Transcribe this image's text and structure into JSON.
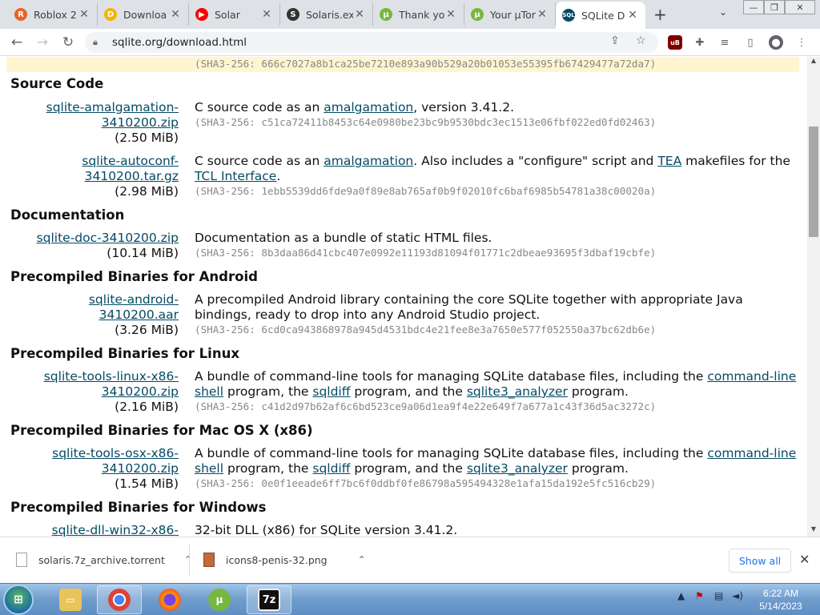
{
  "tabs": [
    {
      "title": "Roblox 2",
      "fav": "R",
      "color": "#e8632c"
    },
    {
      "title": "Downloa",
      "fav": "D",
      "color": "#f4b400"
    },
    {
      "title": "Solar",
      "fav": "▶",
      "color": "#ff0000"
    },
    {
      "title": "Solaris.ex",
      "fav": "S",
      "color": "#333333"
    },
    {
      "title": "Thank yo",
      "fav": "µ",
      "color": "#76b83f"
    },
    {
      "title": "Your µTor",
      "fav": "µ",
      "color": "#76b83f"
    },
    {
      "title": "SQLite D",
      "fav": "SQL",
      "color": "#044a64"
    }
  ],
  "toolbar": {
    "url": "sqlite.org/download.html"
  },
  "content": {
    "top_sha": "(SHA3-256: 666c7027a8b1ca25be7210e893a90b529a20b01053e55395fb67429477a72da7)",
    "sections": [
      {
        "heading": "Source Code",
        "files": [
          {
            "name1": "sqlite-amalgamation-",
            "name2": "3410200.zip",
            "size": "(2.50 MiB)",
            "desc": [
              "C source code as an ",
              {
                "link": "amalgamation"
              },
              ", version 3.41.2."
            ],
            "sha": "(SHA3-256: c51ca72411b8453c64e0980be23bc9b9530bdc3ec1513e06fbf022ed0fd02463)"
          },
          {
            "name1": "sqlite-autoconf-",
            "name2": "3410200.tar.gz",
            "size": "(2.98 MiB)",
            "desc": [
              "C source code as an ",
              {
                "link": "amalgamation"
              },
              ". Also includes a \"configure\" script and ",
              {
                "link": "TEA"
              },
              " makefiles for the ",
              {
                "link": "TCL Interface"
              },
              "."
            ],
            "sha": "(SHA3-256: 1ebb5539dd6fde9a0f89e8ab765af0b9f02010fc6baf6985b54781a38c00020a)"
          }
        ]
      },
      {
        "heading": "Documentation",
        "files": [
          {
            "name1": "sqlite-doc-3410200.zip",
            "name2": "",
            "size": "(10.14 MiB)",
            "desc": [
              "Documentation as a bundle of static HTML files."
            ],
            "sha": "(SHA3-256: 8b3daa86d41cbc407e0992e11193d81094f01771c2dbeae93695f3dbaf19cbfe)"
          }
        ]
      },
      {
        "heading": "Precompiled Binaries for Android",
        "files": [
          {
            "name1": "sqlite-android-",
            "name2": "3410200.aar",
            "size": "(3.26 MiB)",
            "desc": [
              "A precompiled Android library containing the core SQLite together with appropriate Java bindings, ready to drop into any Android Studio project."
            ],
            "sha": "(SHA3-256: 6cd0ca943868978a945d4531bdc4e21fee8e3a7650e577f052550a37bc62db6e)"
          }
        ]
      },
      {
        "heading": "Precompiled Binaries for Linux",
        "files": [
          {
            "name1": "sqlite-tools-linux-x86-",
            "name2": "3410200.zip",
            "size": "(2.16 MiB)",
            "desc": [
              "A bundle of command-line tools for managing SQLite database files, including the ",
              {
                "link": "command-line shell"
              },
              " program, the ",
              {
                "link": "sqldiff"
              },
              " program, and the ",
              {
                "link": "sqlite3_analyzer"
              },
              " program."
            ],
            "sha": "(SHA3-256: c41d2d97b62af6c6bd523ce9a06d1ea9f4e22e649f7a677a1c43f36d5ac3272c)"
          }
        ]
      },
      {
        "heading": "Precompiled Binaries for Mac OS X (x86)",
        "files": [
          {
            "name1": "sqlite-tools-osx-x86-",
            "name2": "3410200.zip",
            "size": "(1.54 MiB)",
            "desc": [
              "A bundle of command-line tools for managing SQLite database files, including the ",
              {
                "link": "command-line shell"
              },
              " program, the ",
              {
                "link": "sqldiff"
              },
              " program, and the ",
              {
                "link": "sqlite3_analyzer"
              },
              " program."
            ],
            "sha": "(SHA3-256: 0e0f1eeade6ff7bc6f0ddbf0fe86798a595494328e1afa15da192e5fc516cb29)"
          }
        ]
      },
      {
        "heading": "Precompiled Binaries for Windows",
        "files": [
          {
            "name1": "sqlite-dll-win32-x86-",
            "name2": "",
            "size": "",
            "desc": [
              "32-bit DLL (x86) for SQLite version 3.41.2."
            ],
            "sha": ""
          }
        ]
      }
    ]
  },
  "downloads": {
    "items": [
      {
        "name": "solaris.7z_archive.torrent"
      },
      {
        "name": "icons8-penis-32.png"
      }
    ],
    "show_all": "Show all"
  },
  "taskbar": {
    "time": "6:22 AM",
    "date": "5/14/2023"
  }
}
